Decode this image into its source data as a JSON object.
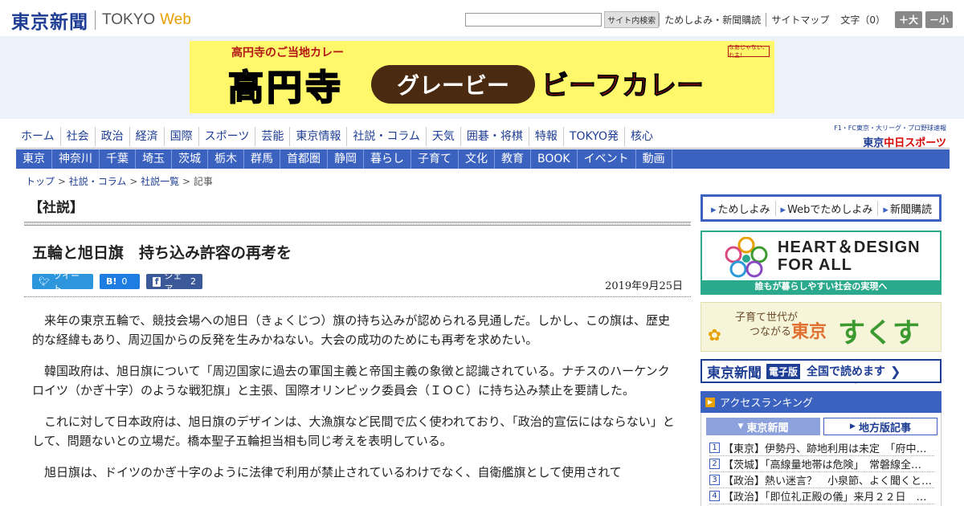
{
  "header": {
    "logo_jp": "東京新聞",
    "logo_tokyo": "TOKYO",
    "logo_web": "Web",
    "search_placeholder": "",
    "search_button": "サイト内検索",
    "links": [
      "ためしよみ・新聞購読",
      "サイトマップ"
    ],
    "font_size_label": "文字（0）",
    "font_up": "＋大",
    "font_down": "－小"
  },
  "banner": {
    "top_text": "高円寺のご当地カレー",
    "big_text": "高円寺",
    "pill_text": "グレービー",
    "red_text": "ビーフカレー",
    "badge_text": "なあじゃない、れ主！"
  },
  "nav_main": [
    "ホーム",
    "社会",
    "政治",
    "経済",
    "国際",
    "スポーツ",
    "芸能",
    "東京情報",
    "社説・コラム",
    "天気",
    "囲碁・将棋",
    "特報",
    "TOKYO発",
    "核心"
  ],
  "sports_promo": {
    "top": "F1・FC東京・大リーグ・プロ野球速報",
    "logo_prefix": "東京",
    "logo_red": "中日スポーツ"
  },
  "nav_regional": [
    "東京",
    "神奈川",
    "千葉",
    "埼玉",
    "茨城",
    "栃木",
    "群馬",
    "首都圏",
    "静岡",
    "暮らし",
    "子育て",
    "文化",
    "教育",
    "BOOK",
    "イベント",
    "動画"
  ],
  "breadcrumb": {
    "items": [
      "トップ",
      "社説・コラム",
      "社説一覧"
    ],
    "current": "記事",
    "separator": ">"
  },
  "article": {
    "section": "【社説】",
    "headline": "五輪と旭日旗　持ち込み許容の再考を",
    "date": "2019年9月25日",
    "share": {
      "tweet": "ツイート",
      "hatena_logo": "B!",
      "hatena_count": "0",
      "facebook": "シェア",
      "facebook_count": "2"
    },
    "paragraphs": [
      "来年の東京五輪で、競技会場への旭日（きょくじつ）旗の持ち込みが認められる見通しだ。しかし、この旗は、歴史的な経緯もあり、周辺国からの反発を生みかねない。大会の成功のためにも再考を求めたい。",
      "韓国政府は、旭日旗について「周辺国家に過去の軍国主義と帝国主義の象徴と認識されている。ナチスのハーケンクロイツ（かぎ十字）のような戦犯旗」と主張、国際オリンピック委員会（ＩＯＣ）に持ち込み禁止を要請した。",
      "これに対して日本政府は、旭日旗のデザインは、大漁旗など民間で広く使われており、「政治的宣伝にはならない」として、問題ないとの立場だ。橋本聖子五輪担当相も同じ考えを表明している。",
      "旭日旗は、ドイツのかぎ十字のように法律で利用が禁止されているわけでなく、自衛艦旗として使用されて"
    ]
  },
  "sidebar": {
    "tabs": [
      "ためしよみ",
      "Webでためしよみ",
      "新聞購読"
    ],
    "heart_title_1": "HEART＆DESIGN",
    "heart_title_2": "FOR ALL",
    "heart_bar": "誰もが暮らしやすい社会の実現へ",
    "suku_small_1": "子育て世代が",
    "suku_small_2": "つながる",
    "suku_tokyo": "東京",
    "suku_main": "すくすく",
    "denshi_logo": "東京新聞",
    "denshi_badge": "電子版",
    "denshi_text": "全国で読めます",
    "ranking_title": "アクセスランキング",
    "ranking_tabs": [
      "東京新聞",
      "地方版記事"
    ],
    "ranking_items": [
      {
        "num": "1",
        "text": "【東京】伊勢丹、跡地利用は未定　「府中…"
      },
      {
        "num": "2",
        "text": "【茨城】「高線量地帯は危険」　常磐線全…"
      },
      {
        "num": "3",
        "text": "【政治】熱い迷言？　小泉節、よく聞くと…"
      },
      {
        "num": "4",
        "text": "【政治】「即位礼正殿の儀」来月２２日　…"
      }
    ]
  },
  "colors": {
    "brand_blue": "#1e3d94",
    "nav_blue": "#3c62c0",
    "accent_orange": "#e8a000",
    "teal": "#2aa98c"
  }
}
